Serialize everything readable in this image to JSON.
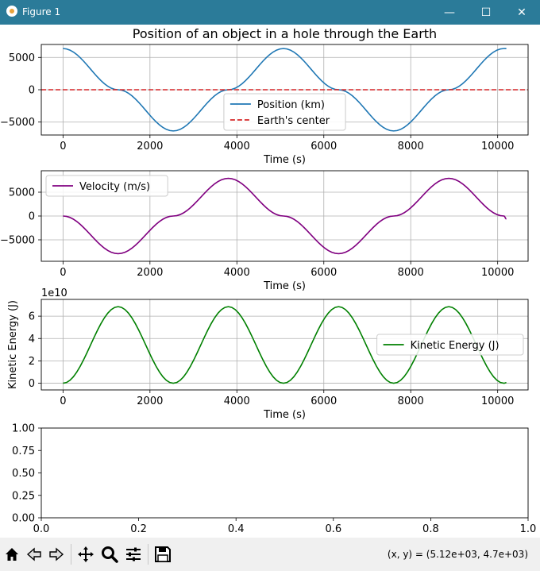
{
  "window": {
    "title": "Figure 1",
    "minimize": "—",
    "maximize": "☐",
    "close": "✕"
  },
  "status": {
    "coords": "(x, y) = (5.12e+03, 4.7e+03)"
  },
  "colors": {
    "position": "#1f77b4",
    "center": "#d62728",
    "velocity": "#800080",
    "energy": "#008000",
    "titlebar": "#2b7b99"
  },
  "toolbar": {
    "icons": [
      "home-icon",
      "back-icon",
      "forward-icon",
      "pan-icon",
      "zoom-icon",
      "configure-icon",
      "save-icon"
    ]
  },
  "chart_data": [
    {
      "type": "line",
      "title": "Position of an object in a hole through the Earth",
      "xlabel": "Time (s)",
      "ylabel": "",
      "xlim": [
        -500,
        10700
      ],
      "ylim": [
        -7000,
        7000
      ],
      "xticks": [
        "0",
        "2000",
        "4000",
        "6000",
        "8000",
        "10000"
      ],
      "yticks": [
        "5000",
        "0",
        "−5000"
      ],
      "grid": true,
      "legend_position": "lower center",
      "series": [
        {
          "name": "Position (km)",
          "style": "solid",
          "x": [
            0,
            1268,
            2536,
            3804,
            5072,
            6340,
            7608,
            8876,
            10144,
            10200
          ],
          "y": [
            6371,
            0,
            -6371,
            0,
            6371,
            0,
            -6371,
            0,
            6371,
            6360
          ]
        },
        {
          "name": "Earth's center",
          "style": "dashed",
          "x": [
            -500,
            10700
          ],
          "y": [
            0,
            0
          ]
        }
      ]
    },
    {
      "type": "line",
      "title": "",
      "xlabel": "Time (s)",
      "ylabel": "",
      "xlim": [
        -500,
        10700
      ],
      "ylim": [
        -9500,
        9500
      ],
      "xticks": [
        "0",
        "2000",
        "4000",
        "6000",
        "8000",
        "10000"
      ],
      "yticks": [
        "5000",
        "0",
        "−5000"
      ],
      "grid": true,
      "legend_position": "upper left",
      "series": [
        {
          "name": "Velocity (m/s)",
          "style": "solid",
          "x": [
            0,
            1268,
            2536,
            3804,
            5072,
            6340,
            7608,
            8876,
            10144,
            10200
          ],
          "y": [
            0,
            -7900,
            0,
            7900,
            0,
            -7900,
            0,
            7900,
            0,
            -620
          ]
        }
      ]
    },
    {
      "type": "line",
      "title": "",
      "xlabel": "Time (s)",
      "ylabel": "Kinetic Energy (J)",
      "offset_label": "1e10",
      "xlim": [
        -500,
        10700
      ],
      "ylim": [
        -0.6,
        7.5
      ],
      "xticks": [
        "0",
        "2000",
        "4000",
        "6000",
        "8000",
        "10000"
      ],
      "yticks": [
        "6",
        "4",
        "2",
        "0"
      ],
      "grid": true,
      "legend_position": "center right",
      "series": [
        {
          "name": "Kinetic Energy (J)",
          "style": "solid",
          "x": [
            0,
            1268,
            2536,
            3804,
            5072,
            6340,
            7608,
            8876,
            10144,
            10200
          ],
          "y": [
            0,
            6.85,
            0,
            6.85,
            0,
            6.85,
            0,
            6.85,
            0,
            0.05
          ]
        }
      ]
    },
    {
      "type": "line",
      "title": "",
      "xlabel": "",
      "ylabel": "",
      "xlim": [
        0,
        1
      ],
      "ylim": [
        0,
        1
      ],
      "xticks": [
        "0.0",
        "0.2",
        "0.4",
        "0.6",
        "0.8",
        "1.0"
      ],
      "yticks": [
        "1.00",
        "0.75",
        "0.50",
        "0.25",
        "0.00"
      ],
      "grid": false,
      "series": []
    }
  ]
}
